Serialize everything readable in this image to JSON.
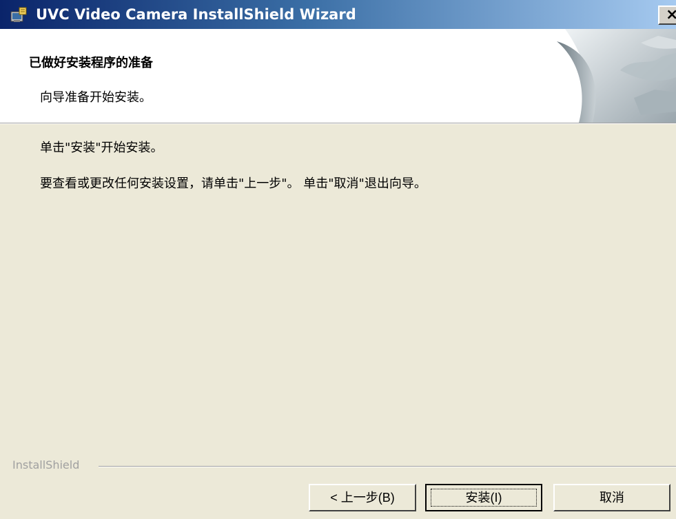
{
  "window": {
    "title": "UVC Video Camera InstallShield Wizard",
    "close_label": "×",
    "icon": "installer-icon"
  },
  "header": {
    "title": "已做好安装程序的准备",
    "subtitle": "向导准备开始安装。"
  },
  "body": {
    "line1": "单击\"安装\"开始安装。",
    "line2": "要查看或更改任何安装设置，请单击\"上一步\"。 单击\"取消\"退出向导。"
  },
  "footer": {
    "brand": "InstallShield",
    "buttons": {
      "back": "< 上一步(B)",
      "install": "安装(I)",
      "cancel": "取消"
    }
  },
  "colors": {
    "titlebar_start": "#0a246a",
    "titlebar_end": "#a6caf0",
    "dialog_bg": "#ece9d8",
    "header_bg": "#ffffff"
  }
}
